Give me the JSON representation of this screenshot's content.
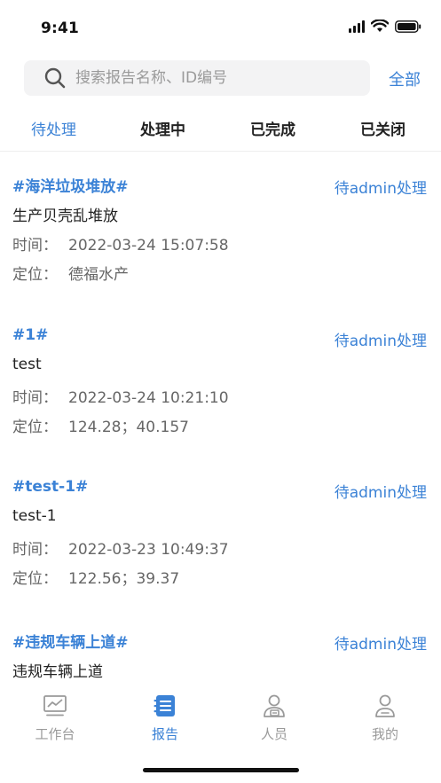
{
  "status_bar": {
    "time": "9:41"
  },
  "search": {
    "placeholder": "搜索报告名称、ID编号",
    "filter_label": "全部"
  },
  "tabs": [
    {
      "label": "待处理",
      "active": true
    },
    {
      "label": "处理中",
      "active": false
    },
    {
      "label": "已完成",
      "active": false
    },
    {
      "label": "已关闭",
      "active": false
    }
  ],
  "reports": [
    {
      "title": "#海洋垃圾堆放#",
      "status": "待admin处理",
      "desc": "生产贝壳乱堆放",
      "time_label": "时间：",
      "time": "2022-03-24 15:07:58",
      "loc_label": "定位：",
      "location": "德福水产"
    },
    {
      "title": "#1#",
      "status": "待admin处理",
      "desc": "test",
      "time_label": "时间：",
      "time": "2022-03-24 10:21:10",
      "loc_label": "定位：",
      "location": "124.28；40.157"
    },
    {
      "title": "#test-1#",
      "status": "待admin处理",
      "desc": "test-1",
      "time_label": "时间：",
      "time": "2022-03-23 10:49:37",
      "loc_label": "定位：",
      "location": "122.56；39.37"
    },
    {
      "title": "#违规车辆上道#",
      "status": "待admin处理",
      "desc": "违规车辆上道",
      "time_label": "",
      "time": "",
      "loc_label": "",
      "location": ""
    }
  ],
  "bottom_nav": [
    {
      "label": "工作台",
      "icon": "dashboard-icon",
      "active": false
    },
    {
      "label": "报告",
      "icon": "report-icon",
      "active": true
    },
    {
      "label": "人员",
      "icon": "people-icon",
      "active": false
    },
    {
      "label": "我的",
      "icon": "profile-icon",
      "active": false
    }
  ],
  "colors": {
    "accent": "#3b82d6",
    "inactive": "#9a9a9a",
    "text": "#222222",
    "secondary": "#666666"
  }
}
